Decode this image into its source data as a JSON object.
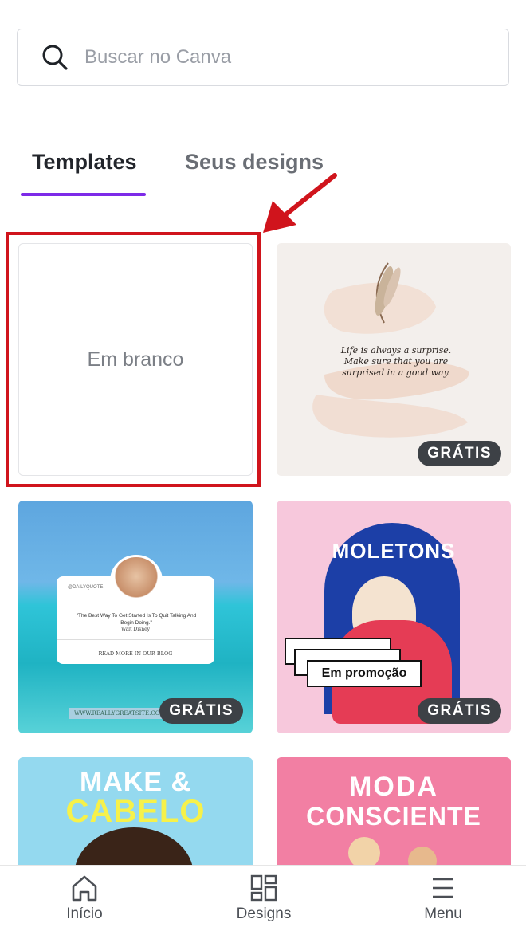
{
  "search": {
    "placeholder": "Buscar no Canva"
  },
  "tabs": [
    {
      "label": "Templates",
      "active": true
    },
    {
      "label": "Seus designs",
      "active": false
    }
  ],
  "cards": {
    "blank": {
      "label": "Em branco"
    },
    "quote_template": {
      "badge": "GRÁTIS",
      "quote": "Life is always a surprise. Make sure that you are surprised in a good way."
    },
    "ocean_template": {
      "badge": "GRÁTIS",
      "handle": "@DAILYQUOTE",
      "quote": "\"The Best Way To Get Started Is To Quit Talking And Begin Doing.\"",
      "author": "Walt Disney",
      "link": "READ MORE IN OUR BLOG",
      "site": "WWW.REALLYGREATSITE.COM"
    },
    "moletons_template": {
      "badge": "GRÁTIS",
      "title": "MOLETONS",
      "promo": "Em promoção"
    },
    "make_template": {
      "line1": "MAKE &",
      "line2": "CABELO"
    },
    "moda_template": {
      "line1": "MODA",
      "line2": "CONSCIENTE"
    }
  },
  "nav": [
    {
      "label": "Início",
      "icon": "home-icon"
    },
    {
      "label": "Designs",
      "icon": "grid-icon"
    },
    {
      "label": "Menu",
      "icon": "hamburger-icon"
    }
  ],
  "colors": {
    "accent": "#7d2ae8",
    "highlight": "#d0141c",
    "arrow": "#d0141c"
  }
}
